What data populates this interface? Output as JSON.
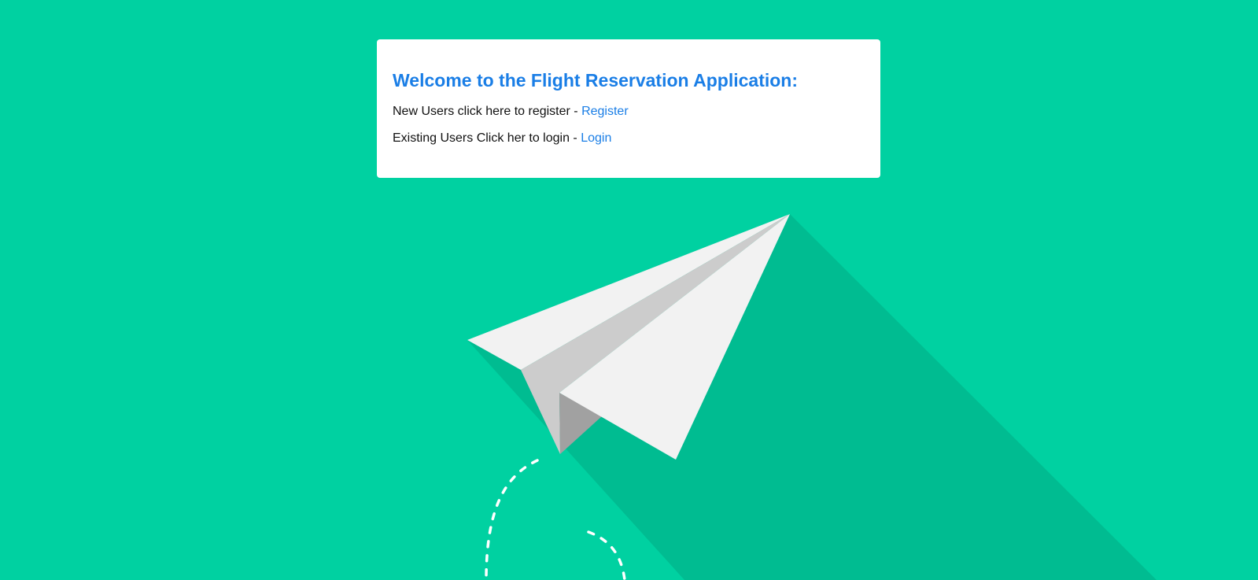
{
  "colors": {
    "background": "#00d1a1",
    "shadow": "#00bc91",
    "paper_light": "#f2f2f2",
    "paper_mid": "#cccccc",
    "paper_dark": "#a1a1a1",
    "trail": "#ffffff",
    "card": "#ffffff",
    "title": "#1a7ee6",
    "link": "#1a7ee6"
  },
  "card": {
    "title": "Welcome to the Flight Reservation Application:",
    "register_line": {
      "text": "New Users click here to register - ",
      "link_label": "Register"
    },
    "login_line": {
      "text": "Existing Users Click her to login - ",
      "link_label": "Login"
    }
  },
  "illustration": {
    "icon": "paper-plane-icon",
    "trail_icon": "dashed-flight-trail-icon"
  }
}
